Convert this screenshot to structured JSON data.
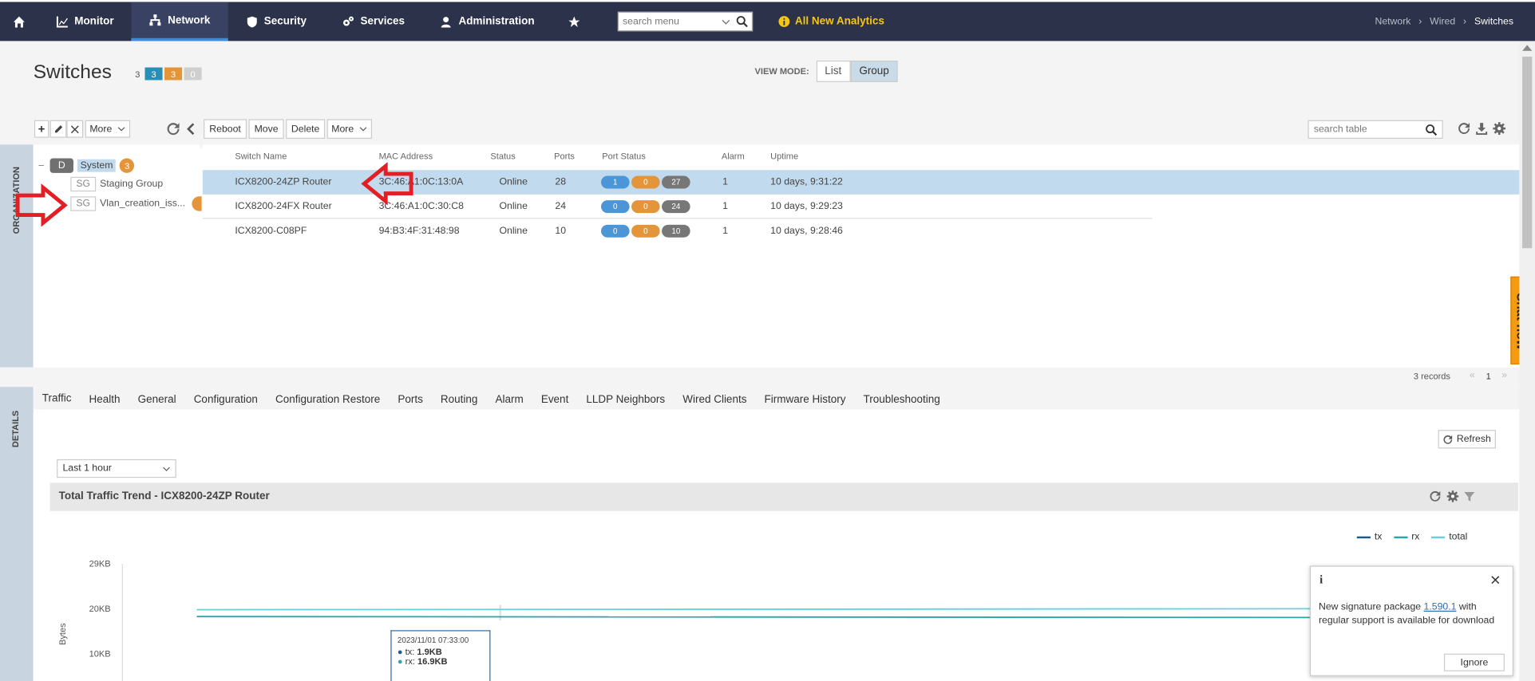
{
  "nav": {
    "items": [
      {
        "label": "Monitor"
      },
      {
        "label": "Network"
      },
      {
        "label": "Security"
      },
      {
        "label": "Services"
      },
      {
        "label": "Administration"
      }
    ],
    "search_placeholder": "search menu",
    "analytics_label": "All New Analytics",
    "breadcrumb": [
      "Network",
      "Wired",
      "Switches"
    ]
  },
  "page": {
    "title": "Switches",
    "total": "3",
    "badges": [
      {
        "value": "3",
        "color": "#2a8fb7"
      },
      {
        "value": "3",
        "color": "#e4953a"
      },
      {
        "value": "0",
        "color": "#cfcfcf"
      }
    ],
    "view_mode_label": "VIEW MODE:",
    "view_modes": [
      "List",
      "Group"
    ],
    "active_view_mode": "Group"
  },
  "org_toolbar": {
    "more_label": "More"
  },
  "table_toolbar": {
    "buttons": [
      "Reboot",
      "Move",
      "Delete",
      "More"
    ],
    "search_placeholder": "search table"
  },
  "side_labels": {
    "organization": "ORGANIZATION",
    "details": "DETAILS"
  },
  "tree": {
    "root": {
      "chip": "D",
      "label": "System",
      "count": "3"
    },
    "children": [
      {
        "chip": "SG",
        "label": "Staging Group"
      },
      {
        "chip": "SG",
        "label": "Vlan_creation_iss..."
      }
    ]
  },
  "table": {
    "headers": [
      "Switch Name",
      "MAC Address",
      "Status",
      "Ports",
      "Port Status",
      "Alarm",
      "Uptime"
    ],
    "rows": [
      {
        "name": "ICX8200-24ZP Router",
        "mac": "3C:46:A1:0C:13:0A",
        "status": "Online",
        "ports": "28",
        "port_status": [
          "1",
          "0",
          "27"
        ],
        "alarm": "1",
        "uptime": "10 days, 9:31:22"
      },
      {
        "name": "ICX8200-24FX Router",
        "mac": "3C:46:A1:0C:30:C8",
        "status": "Online",
        "ports": "24",
        "port_status": [
          "0",
          "0",
          "24"
        ],
        "alarm": "1",
        "uptime": "10 days, 9:29:23"
      },
      {
        "name": "ICX8200-C08PF",
        "mac": "94:B3:4F:31:48:98",
        "status": "Online",
        "ports": "10",
        "port_status": [
          "0",
          "0",
          "10"
        ],
        "alarm": "1",
        "uptime": "10 days, 9:28:46"
      }
    ],
    "records_label": "3 records",
    "page": "1"
  },
  "chat_label": "Chat now",
  "tabs": [
    "Traffic",
    "Health",
    "General",
    "Configuration",
    "Configuration Restore",
    "Ports",
    "Routing",
    "Alarm",
    "Event",
    "LLDP Neighbors",
    "Wired Clients",
    "Firmware History",
    "Troubleshooting"
  ],
  "active_tab": "Traffic",
  "traffic": {
    "refresh_label": "Refresh",
    "range_select": "Last 1 hour",
    "chart_title": "Total Traffic Trend - ICX8200-24ZP Router",
    "legend": [
      {
        "name": "tx",
        "color": "#1d5b8a"
      },
      {
        "name": "rx",
        "color": "#2aa6a6"
      },
      {
        "name": "total",
        "color": "#63d3dc"
      }
    ],
    "y_ticks": [
      "29KB",
      "20KB",
      "10KB"
    ],
    "y_label": "Bytes",
    "tooltip": {
      "time": "2023/11/01 07:33:00",
      "tx": "1.9KB",
      "rx": "16.9KB"
    }
  },
  "chart_data": {
    "type": "line",
    "title": "Total Traffic Trend - ICX8200-24ZP Router",
    "ylabel": "Bytes",
    "y_ticks": [
      "10KB",
      "20KB",
      "29KB"
    ],
    "series": [
      {
        "name": "tx",
        "values": [
          1.9
        ]
      },
      {
        "name": "rx",
        "values": [
          16.9
        ]
      },
      {
        "name": "total",
        "values": [
          18.8
        ]
      }
    ]
  },
  "notification": {
    "text_before": "New signature package ",
    "link": "1.590.1",
    "text_after": " with regular support is available for download",
    "button": "Ignore"
  },
  "colors": {
    "nav_bg": "#2b3249",
    "accent": "#3d8bd9",
    "orange": "#e4953a",
    "row_selected": "#c2daee",
    "arrow": "#e31e24"
  }
}
